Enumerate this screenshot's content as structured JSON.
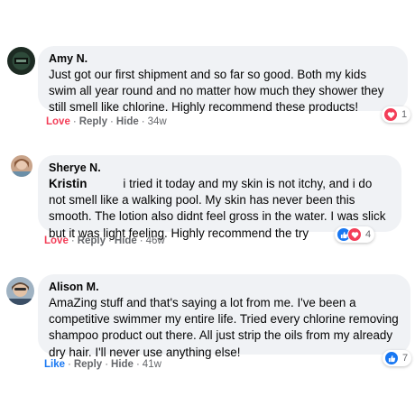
{
  "comments": [
    {
      "name": "Amy N.",
      "text": "Just got our first shipment and so far so good. Both my kids swim all year round and no matter how much they shower they still smell like chlorine. Highly recommend these products!",
      "actions": {
        "primary": "Love",
        "reply": "Reply",
        "hide": "Hide",
        "time": "34w"
      },
      "reaction_count": "1",
      "reaction_icons": [
        "love-icon"
      ]
    },
    {
      "name": "Sherye N.",
      "mention": "Kristin",
      "text": "i tried it today and my skin is not itchy, and i do not smell like a walking pool. My skin has never been this smooth. The lotion also didnt feel gross in the water. I was slick but it was light feeling. Highly recommend the try",
      "actions": {
        "primary": "Love",
        "reply": "Reply",
        "hide": "Hide",
        "time": "46w"
      },
      "reaction_count": "4",
      "reaction_icons": [
        "like-icon",
        "love-icon"
      ]
    },
    {
      "name": "Alison M.",
      "text": "AmaZing stuff and that's saying a lot from me. I've been a competitive swimmer my entire life. Tried every chlorine removing shampoo product out there. All just strip the oils from my already dry hair. I'll never use anything else!",
      "actions": {
        "primary": "Like",
        "reply": "Reply",
        "hide": "Hide",
        "time": "41w"
      },
      "reaction_count": "7",
      "reaction_icons": [
        "like-icon"
      ]
    }
  ],
  "colors": {
    "bubble": "#f0f2f5",
    "love": "#f33e58",
    "like": "#1877f2",
    "meta": "#65676b"
  }
}
